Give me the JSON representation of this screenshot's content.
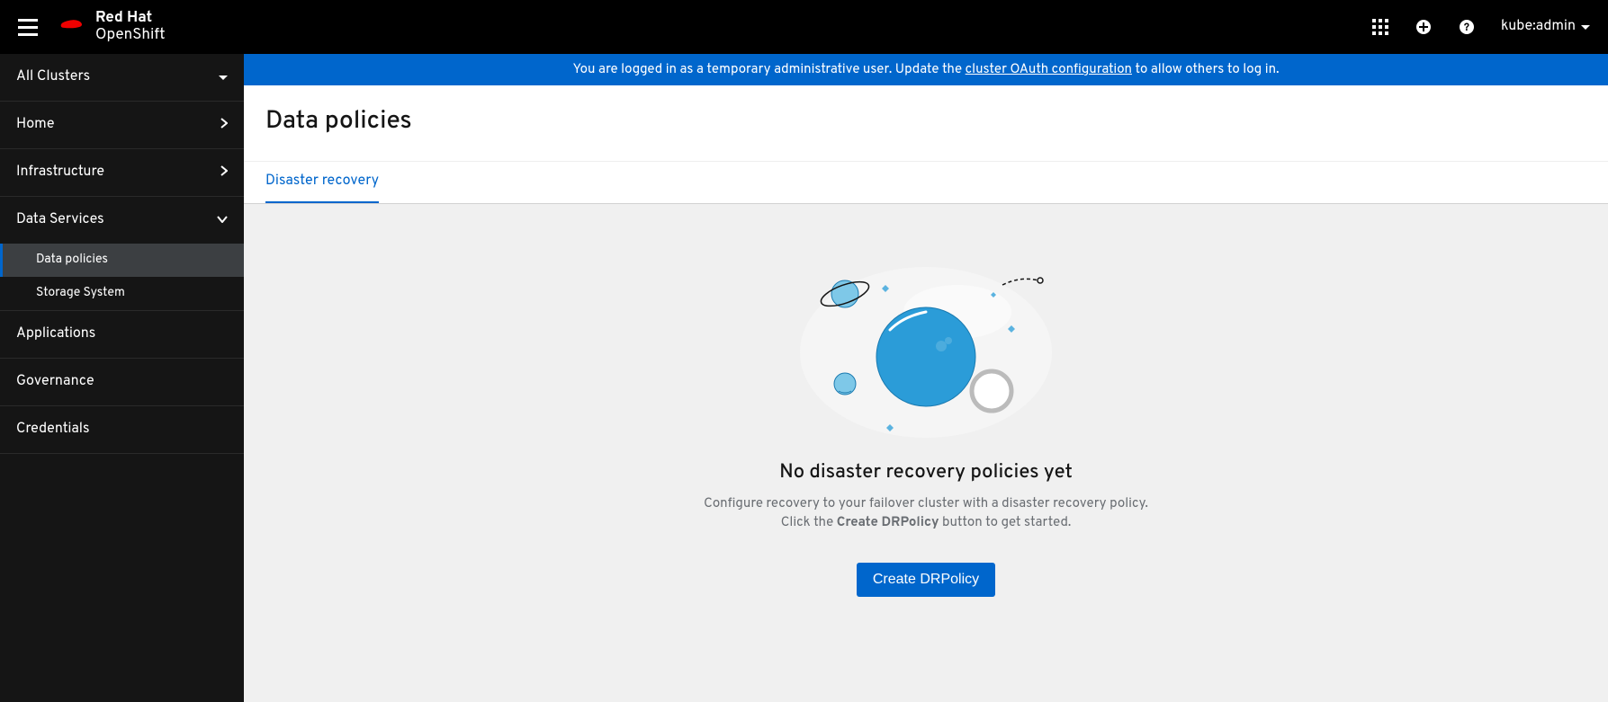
{
  "header": {
    "brand": "Red Hat",
    "product": "OpenShift",
    "user": "kube:admin"
  },
  "banner": {
    "text_before": "You are logged in as a temporary administrative user. Update the ",
    "link_text": "cluster OAuth configuration",
    "text_after": " to allow others to log in."
  },
  "sidebar": {
    "all_clusters": "All Clusters",
    "home": "Home",
    "infrastructure": "Infrastructure",
    "data_services": "Data Services",
    "data_policies": "Data policies",
    "storage_system": "Storage System",
    "applications": "Applications",
    "governance": "Governance",
    "credentials": "Credentials"
  },
  "page": {
    "title": "Data policies",
    "tab": "Disaster recovery"
  },
  "empty": {
    "title": "No disaster recovery policies yet",
    "desc_line1": "Configure recovery to your failover cluster with a disaster recovery policy.",
    "desc_line2_before": "Click the ",
    "desc_line2_bold": "Create DRPolicy",
    "desc_line2_after": " button to get started.",
    "button": "Create DRPolicy"
  }
}
